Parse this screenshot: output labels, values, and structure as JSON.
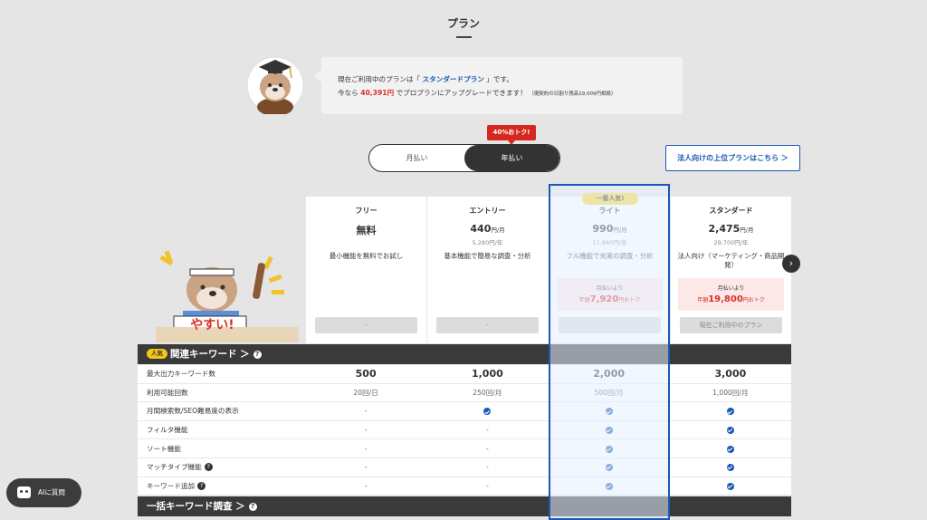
{
  "page": {
    "title": "プラン"
  },
  "notice": {
    "line1_pre": "現在ご利用中のプランは「 ",
    "current_plan": "スタンダードプラン",
    "line1_post": " 」です。",
    "line2_pre": "今なら ",
    "amount": "40,391円",
    "line2_mid": " でプロプランにアップグレードできます！",
    "line2_note": "（現契約の日割り残高19,009円相殺）"
  },
  "billing": {
    "badge": "40%おトク!",
    "monthly": "月払い",
    "yearly": "年払い"
  },
  "corporate_button": "法人向けの上位プランはこちら ＞",
  "plans": [
    {
      "name": "フリー",
      "price": "無料",
      "unit": "",
      "yearly": "",
      "desc": "最小機能を無料でお試し",
      "save1": "",
      "save2_pre": "",
      "save2_amount": "",
      "save2_post": "",
      "button": "-"
    },
    {
      "name": "エントリー",
      "price": "440",
      "unit": "円/月",
      "yearly": "5,280円/年",
      "desc": "基本機能で簡易な調査・分析",
      "save1": "",
      "save2_pre": "",
      "save2_amount": "",
      "save2_post": "",
      "button": "-"
    },
    {
      "name": "ライト",
      "badge": "一番人気!",
      "price": "990",
      "unit": "円/月",
      "yearly": "11,880円/年",
      "desc": "フル機能で充実の調査・分析",
      "save1": "月払いより",
      "save2_pre": "年額",
      "save2_amount": "7,920",
      "save2_post": "円おトク",
      "button": "-"
    },
    {
      "name": "スタンダード",
      "price": "2,475",
      "unit": "円/月",
      "yearly": "29,700円/年",
      "desc": "法人向け（マーケティング・商品開発）",
      "save1": "月払いより",
      "save2_pre": "年額",
      "save2_amount": "19,800",
      "save2_post": "円おトク",
      "button": "現在ご利用中のプラン"
    }
  ],
  "sections": [
    {
      "pill": "人気",
      "title": "関連キーワード ＞",
      "help": "?"
    },
    {
      "title": "一括キーワード調査 ＞",
      "help": "?"
    }
  ],
  "features": [
    {
      "name": "最大出力キーワード数",
      "values": [
        "500",
        "1,000",
        "2,000",
        "3,000"
      ],
      "big": true
    },
    {
      "name": "利用可能回数",
      "values": [
        "20回/日",
        "250回/月",
        "500回/月",
        "1,000回/月"
      ]
    },
    {
      "name": "月間検索数/SEO難易度の表示",
      "values": [
        "-",
        "check",
        "check",
        "check"
      ]
    },
    {
      "name": "フィルタ機能",
      "values": [
        "-",
        "-",
        "check",
        "check"
      ]
    },
    {
      "name": "ソート機能",
      "values": [
        "-",
        "-",
        "check",
        "check"
      ]
    },
    {
      "name": "マッチタイプ機能",
      "help": "?",
      "values": [
        "-",
        "-",
        "check",
        "check"
      ]
    },
    {
      "name": "キーワード追加",
      "help": "?",
      "values": [
        "-",
        "-",
        "check",
        "check"
      ]
    }
  ],
  "mascot_sign": "やすい!",
  "next_arrow": "›",
  "ai_button": "AIに質問",
  "colors": {
    "accent": "#1b57b5",
    "highlight_red": "#d9312a",
    "badge_yellow": "#f5d83c",
    "dark_bar": "#3a3a3a"
  }
}
